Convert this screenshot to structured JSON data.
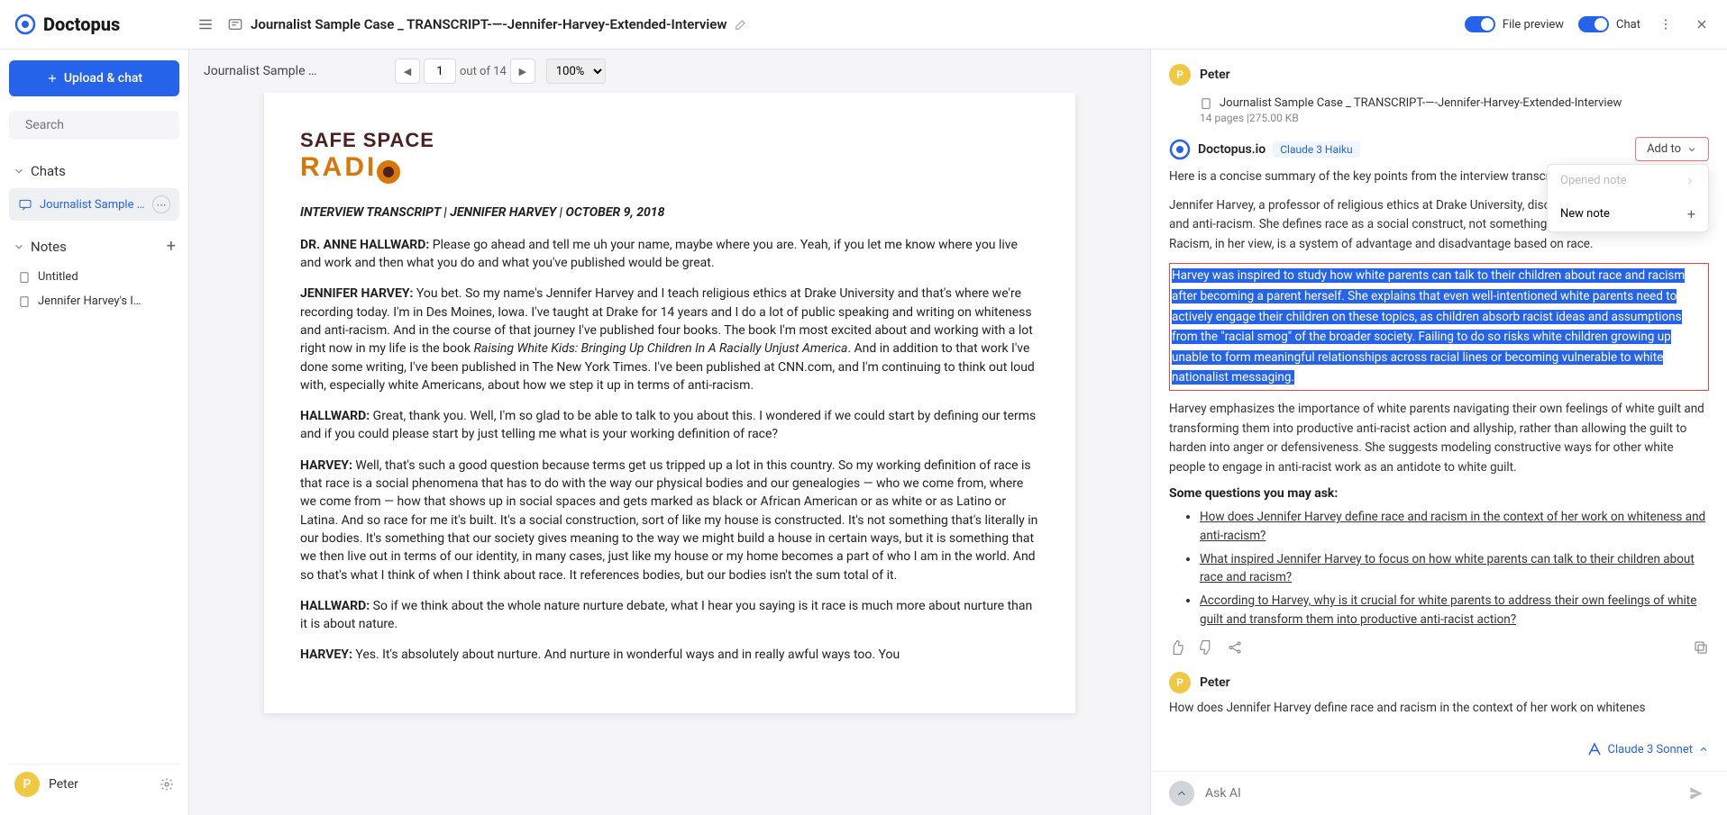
{
  "app": {
    "name": "Doctopus"
  },
  "header": {
    "title": "Journalist Sample Case _ TRANSCRIPT-—-Jennifer-Harvey-Extended-Interview",
    "filePreview": "File preview",
    "chat": "Chat"
  },
  "sidebar": {
    "uploadLabel": "Upload & chat",
    "searchPlaceholder": "Search",
    "chatsLabel": "Chats",
    "chatItem": "Journalist Sample …",
    "notesLabel": "Notes",
    "notes": [
      "Untitled",
      "Jennifer Harvey's I…"
    ],
    "user": "Peter",
    "userInitial": "P"
  },
  "doc": {
    "breadcrumb": "Journalist Sample …",
    "page": "1",
    "totalLabel": "out of 14",
    "zoom": "100%",
    "safe1": "SAFE SPACE",
    "safe2": "RADI",
    "heading": "INTERVIEW TRANSCRIPT | JENNIFER HARVEY | OCTOBER 9, 2018",
    "p1a": "DR. ANNE HALLWARD:",
    "p1b": " Please go ahead and tell me uh your name, maybe where you are. Yeah, if you let me know where you live and work and then what you do and what you've published would be great.",
    "p2a": "JENNIFER HARVEY:",
    "p2b": " You bet. So my name's Jennifer Harvey and I teach religious ethics at Drake University and that's where we're recording today. I'm in Des Moines, Iowa. I've taught at Drake for 14 years and I do a lot of public speaking and writing on whiteness and anti-racism. And in the course of that journey I've published four books. The book I'm most excited about and working with a lot right now in my life is the book ",
    "p2c": "Raising White Kids: Bringing Up Children In A Racially Unjust America",
    "p2d": ". And in addition to that work I've done some writing, I've been published in The New York Times. I've been published at CNN.com, and I'm continuing to think out loud with, especially white Americans, about how we step it up in terms of anti-racism.",
    "p3a": "HALLWARD:",
    "p3b": " Great, thank you. Well, I'm so glad to be able to talk to you about this. I wondered if we could start by defining our terms and if you could please start by just telling me what is your working definition of race?",
    "p4a": "HARVEY:",
    "p4b": " Well, that's such a good question because terms get us tripped up a lot in this country. So my working definition of race is that race is a social phenomena that has to do with the way our physical bodies and our genealogies — who we come from, where we come from — how that shows up in social spaces and gets marked as black or African American or as white or as Latino or Latina. And so race for me it's built. It's a social construction, sort of like my house is constructed. It's not something that's literally in our bodies. It's something that our society gives meaning to the way we might build a house in certain ways, but it is something that we then live out in terms of our identity, in many cases, just like my house or my home becomes a part of who I am in the world. And so that's what I think of when I think about race. It references bodies, but our bodies isn't the sum total of it.",
    "p5a": "HALLWARD:",
    "p5b": " So if we think about the whole nature nurture debate, what I hear you saying is it race is much more about nurture than it is about nature.",
    "p6a": "HARVEY:",
    "p6b": " Yes. It's absolutely about nurture. And nurture in wonderful ways and in really awful ways too. You"
  },
  "chat": {
    "user": "Peter",
    "userInitial": "P",
    "fileRef": "Journalist Sample Case _ TRANSCRIPT-—-Jennifer-Harvey-Extended-Interview",
    "fileMeta": "14 pages |275.00 KB",
    "botName": "Doctopus.io",
    "modelBadge": "Claude 3 Haiku",
    "addTo": "Add to",
    "menuOpened": "Opened note",
    "menuNew": "New note",
    "intro": "Here is a concise summary of the key points from the interview transcript:",
    "para1": "Jennifer Harvey, a professor of religious ethics at Drake University, discusses her work on whiteness and anti-racism. She defines race as a social construct, not something inherent in our biology. Racism, in her view, is a system of advantage and disadvantage based on race.",
    "highlight": "Harvey was inspired to study how white parents can talk to their children about race and racism after becoming a parent herself. She explains that even well-intentioned white parents need to actively engage their children on these topics, as children absorb racist ideas and assumptions from the \"racial smog\" of the broader society. Failing to do so risks white children growing up unable to form meaningful relationships across racial lines or becoming vulnerable to white nationalist messaging.",
    "para2": "Harvey emphasizes the importance of white parents navigating their own feelings of white guilt and transforming them into productive anti-racist action and allyship, rather than allowing the guilt to harden into anger or defensiveness. She suggests modeling constructive ways for other white people to engage in anti-racist work as an antidote to white guilt.",
    "questionsHead": "Some questions you may ask:",
    "q1": "How does Jennifer Harvey define race and racism in the context of her work on whiteness and anti-racism?",
    "q2": "What inspired Jennifer Harvey to focus on how white parents can talk to their children about race and racism?",
    "q3": "According to Harvey, why is it crucial for white parents to address their own feelings of white guilt and transform them into productive anti-racist action?",
    "userQ": "How does Jennifer Harvey define race and racism in the context of her work on whitenes",
    "modelSel": "Claude 3 Sonnet",
    "askPlaceholder": "Ask AI"
  }
}
